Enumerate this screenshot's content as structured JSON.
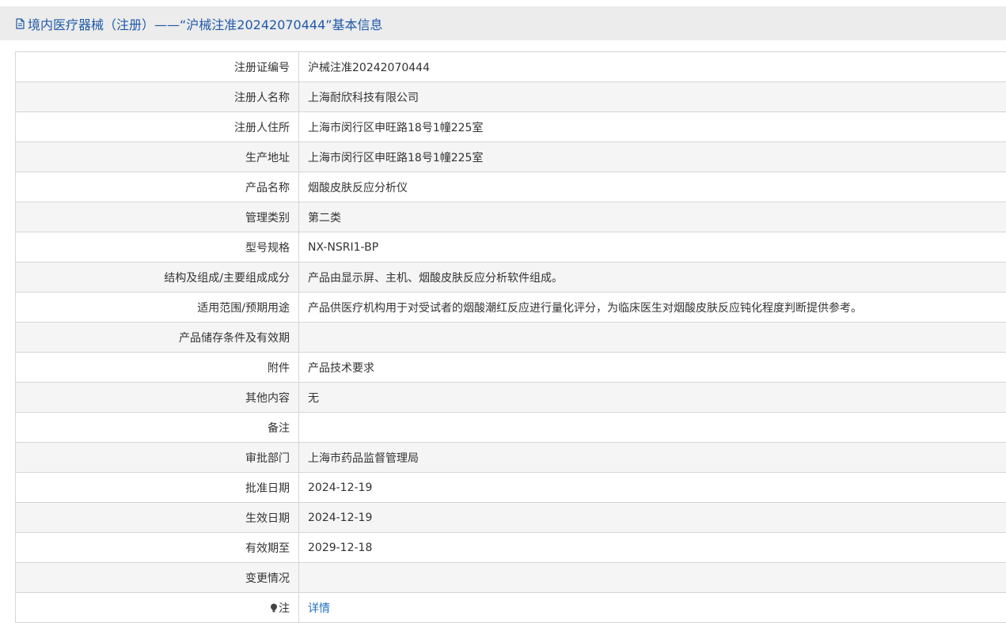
{
  "header": {
    "title": "境内医疗器械（注册）——“沪械注准20242070444”基本信息",
    "icon": "document-icon",
    "color": "#1f5aa8"
  },
  "rows": [
    {
      "label": "注册证编号",
      "value": "沪械注准20242070444"
    },
    {
      "label": "注册人名称",
      "value": "上海耐欣科技有限公司"
    },
    {
      "label": "注册人住所",
      "value": "上海市闵行区申旺路18号1幢225室"
    },
    {
      "label": "生产地址",
      "value": "上海市闵行区申旺路18号1幢225室"
    },
    {
      "label": "产品名称",
      "value": "烟酸皮肤反应分析仪"
    },
    {
      "label": "管理类别",
      "value": "第二类"
    },
    {
      "label": "型号规格",
      "value": "NX-NSRI1-BP"
    },
    {
      "label": "结构及组成/主要组成成分",
      "value": "产品由显示屏、主机、烟酸皮肤反应分析软件组成。"
    },
    {
      "label": "适用范围/预期用途",
      "value": "产品供医疗机构用于对受试者的烟酸潮红反应进行量化评分，为临床医生对烟酸皮肤反应钝化程度判断提供参考。"
    },
    {
      "label": "产品储存条件及有效期",
      "value": ""
    },
    {
      "label": "附件",
      "value": "产品技术要求"
    },
    {
      "label": "其他内容",
      "value": "无"
    },
    {
      "label": "备注",
      "value": ""
    },
    {
      "label": "审批部门",
      "value": "上海市药品监督管理局"
    },
    {
      "label": "批准日期",
      "value": "2024-12-19"
    },
    {
      "label": "生效日期",
      "value": "2024-12-19"
    },
    {
      "label": "有效期至",
      "value": "2029-12-18"
    },
    {
      "label": "变更情况",
      "value": ""
    }
  ],
  "note_row": {
    "icon": "lightbulb-icon",
    "label": "注",
    "link_text": "详情",
    "link_color": "#1f6fc5"
  }
}
